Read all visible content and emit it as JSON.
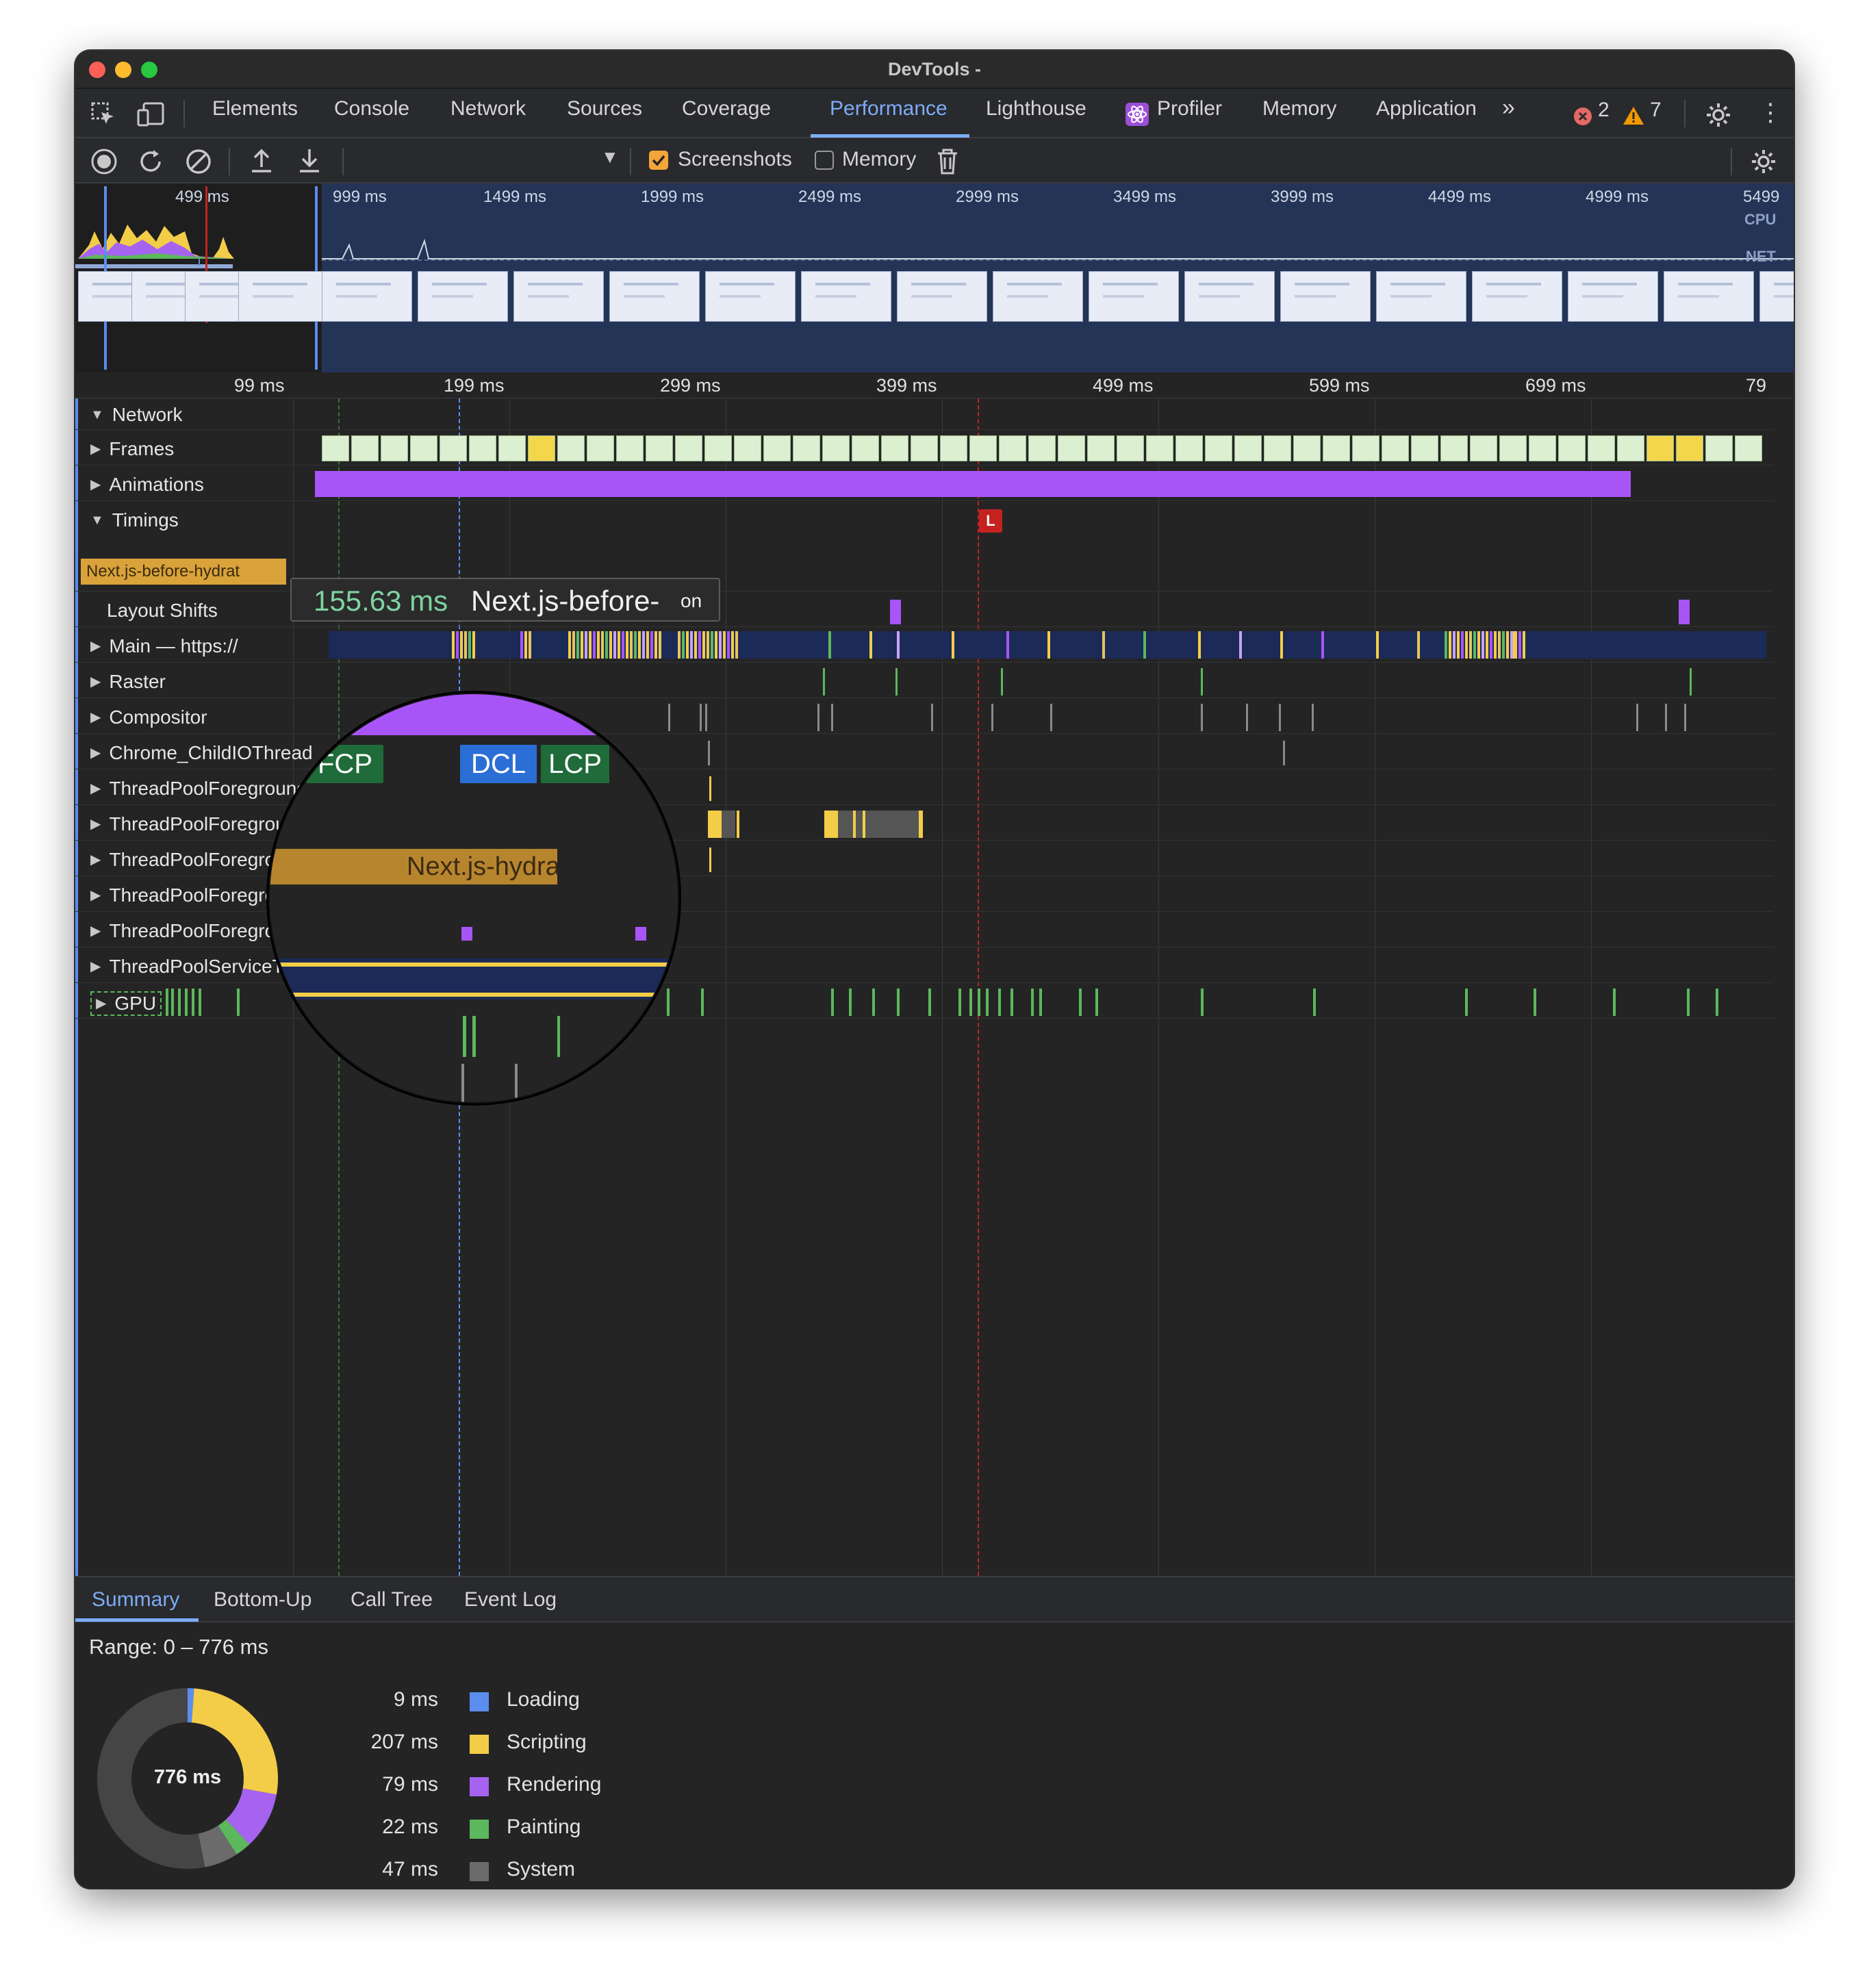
{
  "window": {
    "title": "DevTools -"
  },
  "tabs": [
    "Elements",
    "Console",
    "Network",
    "Sources",
    "Coverage",
    "Performance",
    "Lighthouse",
    "Profiler",
    "Memory",
    "Application"
  ],
  "active_tab": "Performance",
  "status": {
    "errors": "2",
    "warnings": "7"
  },
  "toolbar": {
    "screenshots_label": "Screenshots",
    "screenshots_checked": true,
    "memory_label": "Memory",
    "memory_checked": false
  },
  "overview": {
    "ticks": [
      "499 ms",
      "999 ms",
      "1499 ms",
      "1999 ms",
      "2499 ms",
      "2999 ms",
      "3499 ms",
      "3999 ms",
      "4499 ms",
      "4999 ms",
      "5499"
    ],
    "cpu_label": "CPU",
    "net_label": "NET"
  },
  "ruler": [
    "99 ms",
    "199 ms",
    "299 ms",
    "399 ms",
    "499 ms",
    "599 ms",
    "699 ms",
    "79"
  ],
  "tracks": {
    "network": "Network",
    "frames": "Frames",
    "animations": "Animations",
    "timings": "Timings",
    "timing_event": "Next.js-before-hydrat",
    "lcp_marker": "L",
    "layout_shifts": "Layout Shifts",
    "main": "Main — https://",
    "raster": "Raster",
    "compositor": "Compositor",
    "childio": "Chrome_ChildIOThread",
    "workers": [
      "ThreadPoolForegroundWorker",
      "ThreadPoolForegroundWorker",
      "ThreadPoolForegroundWorker",
      "ThreadPoolForegroundWorker",
      "ThreadPoolForegroundWorker"
    ],
    "service": "ThreadPoolServiceThread",
    "gpu": "GPU"
  },
  "magnifier": {
    "markers": [
      "P",
      "FCP",
      "DCL",
      "LCP"
    ],
    "event_text": "Next.js-hydration",
    "tooltip_time": "155.63 ms",
    "tooltip_name": "Next.js-before-",
    "tooltip_tail": "on"
  },
  "bottom_tabs": [
    "Summary",
    "Bottom-Up",
    "Call Tree",
    "Event Log"
  ],
  "summary": {
    "range": "Range: 0 – 776 ms",
    "total": "776 ms",
    "items": [
      {
        "value": "9 ms",
        "label": "Loading",
        "ms": 9,
        "color": "#5b8def"
      },
      {
        "value": "207 ms",
        "label": "Scripting",
        "ms": 207,
        "color": "#f3cd47"
      },
      {
        "value": "79 ms",
        "label": "Rendering",
        "ms": 79,
        "color": "#a563f0"
      },
      {
        "value": "22 ms",
        "label": "Painting",
        "ms": 22,
        "color": "#5cb85c"
      },
      {
        "value": "47 ms",
        "label": "System",
        "ms": 47,
        "color": "#6b6b6b"
      }
    ]
  },
  "colors": {
    "accent": "#7cacf8",
    "scripting": "#f3cd47",
    "rendering": "#a563f0",
    "painting": "#5cb85c",
    "frames": "#dcefd0",
    "lcp": "#c5221f",
    "error": "#e46962",
    "warning": "#f29900"
  }
}
